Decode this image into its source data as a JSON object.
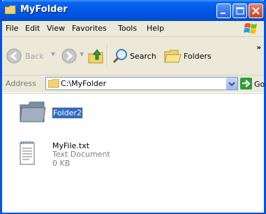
{
  "window": {
    "title": "MyFolder"
  },
  "menu": [
    "File",
    "Edit",
    "View",
    "Favorites",
    "Tools",
    "Help"
  ],
  "toolbar": {
    "back": "Back",
    "search": "Search",
    "folders": "Folders"
  },
  "address": {
    "label": "Address",
    "path": "C:\\MyFolder",
    "go": "Go"
  },
  "items": [
    {
      "name": "Folder2",
      "selected": true,
      "icon": "folder-icon"
    },
    {
      "name": "MyFile.txt",
      "type": "Text Document",
      "size": "0 KB",
      "icon": "text-document-icon"
    }
  ],
  "colors": {
    "titlebar": "#0058e6",
    "selection": "#316ac5",
    "chrome": "#ece9d8"
  }
}
